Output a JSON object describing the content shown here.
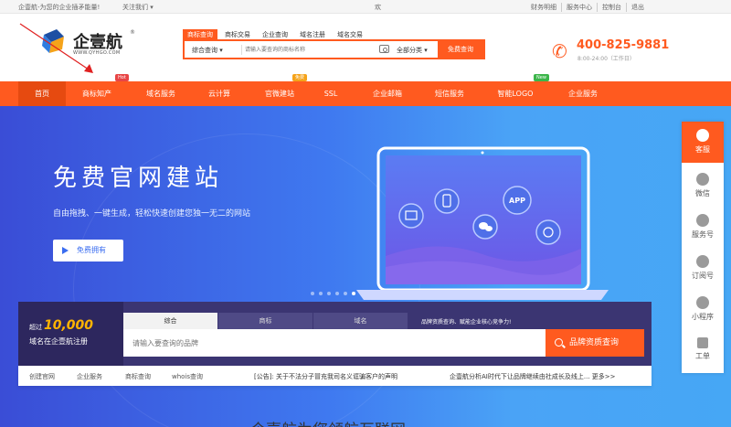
{
  "topbar": {
    "left_text": "企壹航-为您的企业插矛能量!",
    "follow": "关注我们 ▾",
    "middle": "欢",
    "links": [
      "财务明细",
      "服务中心",
      "控制台",
      "退出"
    ]
  },
  "logo": {
    "name": "企壹航",
    "url": "WWW.QYHGO.COM",
    "reg": "®"
  },
  "search": {
    "tabs": [
      "商标查询",
      "商标交易",
      "企业查询",
      "域名注册",
      "域名交易"
    ],
    "active_tab": 0,
    "type_select": "综合查询 ▾",
    "placeholder": "请输入要查询的商标名称",
    "category_select": "全部分类 ▾",
    "button": "免费查询"
  },
  "phone": {
    "number": "400-825-9881",
    "hours": "8:00-24:00（工作日）"
  },
  "nav": {
    "items": [
      "首页",
      "商标知产",
      "域名服务",
      "云计算",
      "官微建站",
      "SSL",
      "企业邮箱",
      "短信服务",
      "智能LOGO",
      "企业服务"
    ],
    "badges": {
      "hot": "Hot",
      "free": "免费",
      "new": "New"
    }
  },
  "hero": {
    "title": "免费官网建站",
    "subtitle": "自由拖拽、一键生成，轻松快速创建您独一无二的网站",
    "cta": "免费拥有",
    "app_label": "APP"
  },
  "panel": {
    "line1_prefix": "超过",
    "line1_number": "10,000",
    "line2": "域名在企壹航注册",
    "tabs": [
      "综合",
      "商标",
      "域名"
    ],
    "tip": "品牌资质查询、赋能企业核心竞争力!",
    "placeholder": "请输入要查询的品牌",
    "button": "品牌资质查询"
  },
  "panelbar": {
    "links": [
      "创建官网",
      "企业服务",
      "商标查询",
      "whois查询"
    ],
    "notice": "[公告]: 关于不法分子冒充我司名义诓骗客户的声明",
    "news": "企壹航分析AI时代下让品牌继续由社成长及线上... 更多>>"
  },
  "bottom_title": "企壹航为您领航互联网",
  "sidebar": {
    "items": [
      "客服",
      "微信",
      "服务号",
      "订阅号",
      "小程序",
      "工单"
    ]
  },
  "colors": {
    "accent": "#ff5a1f",
    "panel": "#3b3572",
    "hero_start": "#3a4dd6",
    "hero_end": "#46a7f5",
    "gold": "#ffb400"
  }
}
